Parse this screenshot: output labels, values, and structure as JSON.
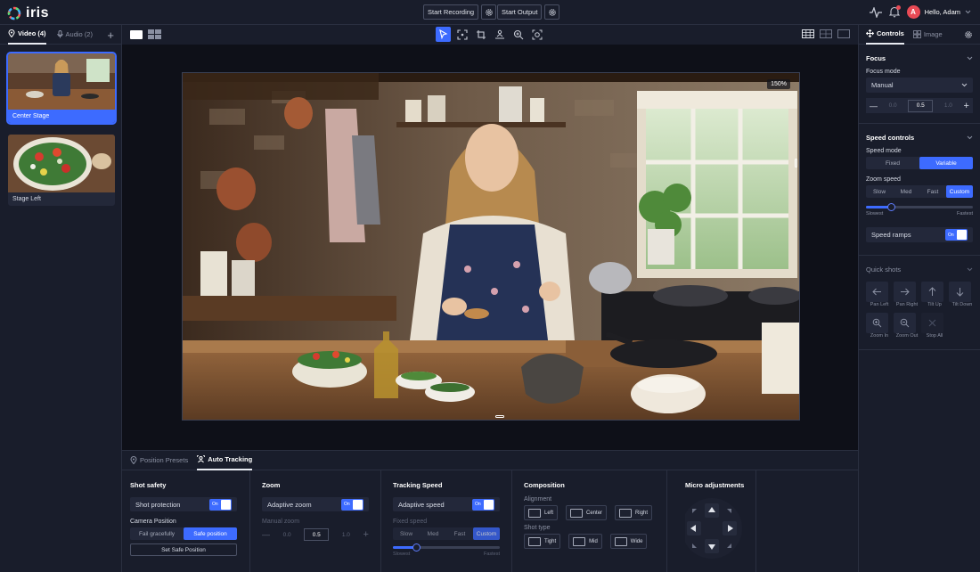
{
  "app": {
    "name": "iris"
  },
  "topbar": {
    "start_recording": "Start Recording",
    "start_output": "Start Output",
    "greeting": "Hello, Adam",
    "avatar_initial": "A"
  },
  "left_panel": {
    "tabs": [
      {
        "label": "Video (4)"
      },
      {
        "label": "Audio (2)"
      }
    ],
    "cards": [
      {
        "label": "Center Stage"
      },
      {
        "label": "Stage Left"
      }
    ]
  },
  "viewport": {
    "zoom": "150%"
  },
  "bottom": {
    "tabs": [
      {
        "label": "Position Presets"
      },
      {
        "label": "Auto Tracking"
      }
    ],
    "shot_safety": {
      "title": "Shot safety",
      "shot_protection": "Shot protection",
      "toggle_on": "On",
      "camera_position_label": "Camera Position",
      "options": [
        "Fail gracefully",
        "Safe position"
      ],
      "selected": "Safe position",
      "set_button": "Set Safe Position"
    },
    "zoom": {
      "title": "Zoom",
      "adaptive": "Adaptive zoom",
      "toggle_on": "On",
      "manual_label": "Manual zoom",
      "minus": "—",
      "values": [
        "0.0",
        "0.5",
        "1.0"
      ],
      "plus": "+"
    },
    "tracking": {
      "title": "Tracking Speed",
      "adaptive": "Adaptive speed",
      "toggle_on": "On",
      "fixed_label": "Fixed speed",
      "options": [
        "Slow",
        "Med",
        "Fast",
        "Custom"
      ],
      "selected": "Custom",
      "slider_min": "Slowest",
      "slider_max": "Fastest",
      "slider_value": 0.22
    },
    "composition": {
      "title": "Composition",
      "alignment_label": "Alignment",
      "alignment": [
        "Left",
        "Center",
        "Right"
      ],
      "shot_type_label": "Shot type",
      "shot_types": [
        "Tight",
        "Mid",
        "Wide"
      ]
    },
    "micro": {
      "title": "Micro adjustments"
    }
  },
  "right_panel": {
    "tabs": [
      {
        "label": "Controls"
      },
      {
        "label": "Image"
      }
    ],
    "focus": {
      "title": "Focus",
      "mode_label": "Focus mode",
      "mode_value": "Manual",
      "minus": "—",
      "values": [
        "0.0",
        "0.5",
        "1.0"
      ],
      "plus": "+"
    },
    "speed": {
      "title": "Speed controls",
      "mode_label": "Speed mode",
      "modes": [
        "Fixed",
        "Variable"
      ],
      "selected_mode": "Variable",
      "zoom_speed_label": "Zoom speed",
      "zoom_speeds": [
        "Slow",
        "Med",
        "Fast",
        "Custom"
      ],
      "selected_zoom_speed": "Custom",
      "slider_min": "Slowest",
      "slider_max": "Fastest",
      "slider_value": 0.23,
      "ramps_label": "Speed ramps",
      "toggle_on": "On"
    },
    "quick_shots": {
      "title": "Quick shots",
      "items": [
        {
          "label": "Pan Left",
          "icon": "arrow-left-icon"
        },
        {
          "label": "Pan Right",
          "icon": "arrow-right-icon"
        },
        {
          "label": "Tilt Up",
          "icon": "arrow-up-icon"
        },
        {
          "label": "Tilt Down",
          "icon": "arrow-down-icon"
        },
        {
          "label": "Zoom In",
          "icon": "zoom-in-icon"
        },
        {
          "label": "Zoom Out",
          "icon": "zoom-out-icon"
        },
        {
          "label": "Stop All",
          "icon": "stop-icon"
        }
      ]
    }
  },
  "colors": {
    "accent": "#3d6bff",
    "background": "#191d2b",
    "avatar": "#e84a55"
  }
}
